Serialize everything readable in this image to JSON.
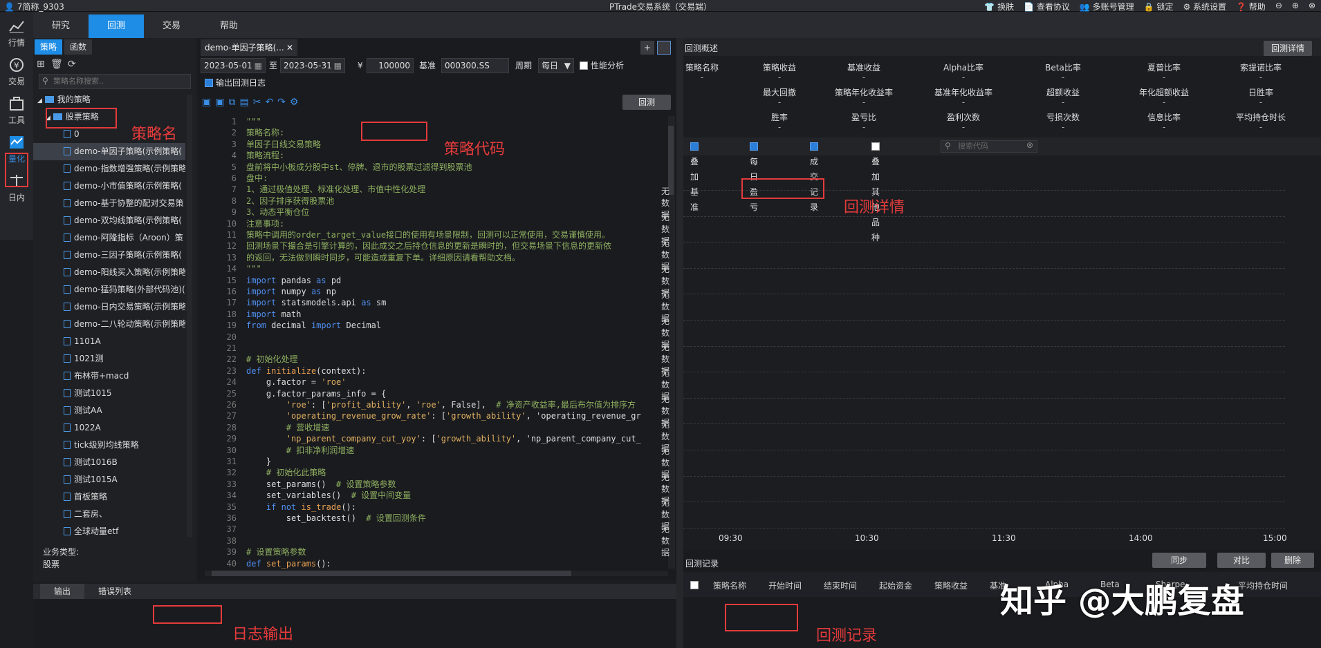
{
  "titlebar": {
    "user": "7简称_9303",
    "title": "PTrade交易系统（交易端）",
    "actions": [
      "换肤",
      "查看协议",
      "多账号管理",
      "锁定",
      "系统设置",
      "帮助"
    ]
  },
  "leftnav": [
    {
      "label": "行情",
      "icon": "chart-icon"
    },
    {
      "label": "交易",
      "icon": "yen-icon"
    },
    {
      "label": "工具",
      "icon": "toolbox-icon"
    },
    {
      "label": "量化",
      "icon": "quant-icon"
    },
    {
      "label": "日内",
      "icon": "balance-icon"
    }
  ],
  "menu": [
    "研究",
    "回测",
    "交易",
    "帮助"
  ],
  "tree": {
    "tabs": [
      "策略",
      "函数"
    ],
    "search_placeholder": "策略名称搜索..",
    "root": "我的策略",
    "folder": "股票策略",
    "items": [
      "0",
      "demo-单因子策略(示例策略(",
      "demo-指数增强策略(示例策略",
      "demo-小市值策略(示例策略(",
      "demo-基于协整的配对交易策",
      "demo-双均线策略(示例策略(",
      "demo-阿隆指标（Aroon）策",
      "demo-三因子策略(示例策略(",
      "demo-阳线买入策略(示例策略",
      "demo-猛犸策略(外部代码池)(",
      "demo-日内交易策略(示例策略",
      "demo-二八轮动策略(示例策略",
      "1101A",
      "1021测",
      "布林带+macd",
      "测试1015",
      "测试AA",
      "1022A",
      "tick级别均线策略",
      "测试1016B",
      "测试1015A",
      "首板策略",
      "二套房、",
      "全球动量etf"
    ]
  },
  "biz": {
    "label": "业务类型:",
    "value": "股票"
  },
  "editor": {
    "tab": "demo-单因子策略(...",
    "start": "2023-05-01",
    "to": "至",
    "end": "2023-05-31",
    "yen": "¥",
    "capital": "100000",
    "bench_label": "基准",
    "bench": "000300.SS",
    "period_label": "周期",
    "period": "每日",
    "perf": "性能分析",
    "log_out": "输出回测日志",
    "run": "回测"
  },
  "code": [
    "\"\"\"",
    "策略名称:",
    "单因子日线交易策略",
    "策略流程:",
    "盘前将中小板成分股中st、停牌、退市的股票过滤得到股票池",
    "盘中:",
    "1、通过极值处理、标准化处理、市值中性化处理",
    "2、因子排序获得股票池",
    "3、动态平衡仓位",
    "注意事项:",
    "策略中调用的order_target_value接口的使用有场景限制，回测可以正常使用，交易谨慎使用。",
    "回测场景下撮合是引擎计算的，因此成交之后持仓信息的更新是瞬时的，但交易场景下信息的更新依",
    "的返回，无法做到瞬时同步，可能造成重复下单。详细原因请看帮助文档。",
    "\"\"\"",
    "import pandas as pd",
    "import numpy as np",
    "import statsmodels.api as sm",
    "import math",
    "from decimal import Decimal",
    "",
    "",
    "# 初始化处理",
    "def initialize(context):",
    "    g.factor = 'roe'",
    "    g.factor_params_info = {",
    "        'roe': ['profit_ability', 'roe', False],  # 净资产收益率,最后布尔值为排序方",
    "        'operating_revenue_grow_rate': ['growth_ability', 'operating_revenue_gr",
    "        # 营收增速",
    "        'np_parent_company_cut_yoy': ['growth_ability', 'np_parent_company_cut_",
    "        # 扣非净利润增速",
    "    }",
    "    # 初始化此策略",
    "    set_params()  # 设置策略参数",
    "    set_variables()  # 设置中间变量",
    "    if not is_trade():",
    "        set_backtest()  # 设置回测条件",
    "",
    "",
    "# 设置策略参数",
    "def set_params():"
  ],
  "output": {
    "tabs": [
      "输出",
      "错误列表"
    ]
  },
  "annotations": {
    "strategy_name": "策略名",
    "strategy_code": "策略代码",
    "detail": "回测详情",
    "log": "日志输出",
    "records": "回测记录"
  },
  "backtest": {
    "overview": "回测概述",
    "detail_btn": "回测详情",
    "metrics": [
      "策略名称",
      "策略收益",
      "基准收益",
      "Alpha比率",
      "Beta比率",
      "夏普比率",
      "索提诺比率",
      "最大回撤",
      "策略年化收益率",
      "基准年化收益率",
      "超额收益",
      "年化超额收益",
      "日胜率",
      "胜率",
      "盈亏比",
      "盈利次数",
      "亏损次数",
      "信息比率",
      "平均持仓时长"
    ],
    "dash": "-",
    "checks": [
      {
        "label": "叠加基准",
        "on": true
      },
      {
        "label": "每日盈亏",
        "on": true
      },
      {
        "label": "成交记录",
        "on": true
      },
      {
        "label": "叠加其他品种",
        "on": false
      }
    ],
    "search_placeholder": "搜索代码",
    "nodata": "无数据",
    "xticks": [
      "09:30",
      "10:30",
      "11:30",
      "14:00",
      "15:00"
    ]
  },
  "records": {
    "title": "回测记录",
    "buttons": [
      "同步",
      "对比",
      "删除"
    ],
    "columns": [
      "策略名称",
      "开始时间",
      "结束时间",
      "起始资金",
      "策略收益",
      "基准",
      "Alpha",
      "Beta",
      "Sharpe",
      "平均持仓时间"
    ]
  },
  "watermark": "知乎 @大鹏复盘"
}
